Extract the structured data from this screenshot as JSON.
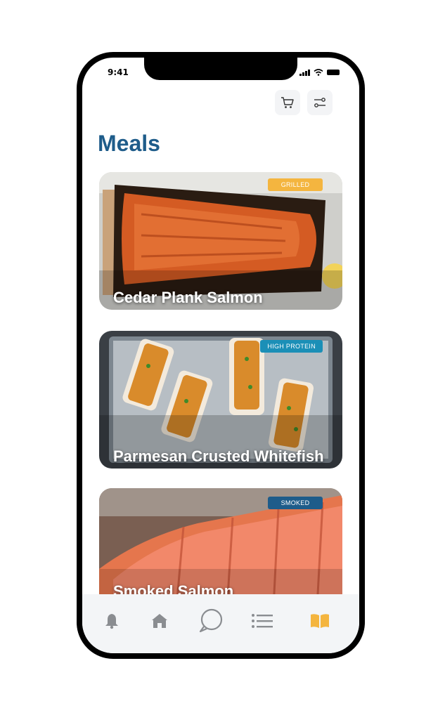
{
  "status": {
    "time": "9:41"
  },
  "header": {
    "title": "Meals",
    "cart_icon": "cart-icon",
    "filter_icon": "filter-icon"
  },
  "meals": [
    {
      "title": "Cedar Plank Salmon",
      "tag": "GRILLED",
      "tag_color": "#f4b53f"
    },
    {
      "title": "Parmesan Crusted Whitefish",
      "tag": "HIGH PROTEIN",
      "tag_color": "#1b8fb7"
    },
    {
      "title": "Smoked Salmon",
      "tag": "SMOKED",
      "tag_color": "#1e5c8a"
    }
  ],
  "tab_bar": {
    "items": [
      "bell-icon",
      "home-icon",
      "chat-icon",
      "list-icon",
      "book-icon"
    ],
    "active": "book-icon",
    "active_color": "#f4b53f",
    "inactive_color": "#8a8d91"
  },
  "colors": {
    "accent": "#1e5c8a"
  }
}
